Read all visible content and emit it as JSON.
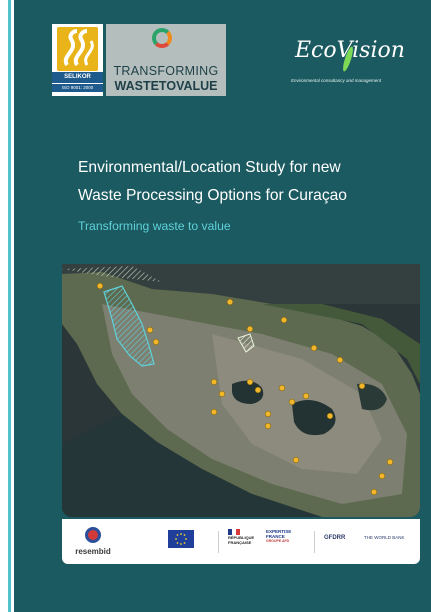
{
  "header": {
    "selikor": {
      "name": "SELIKOR",
      "iso": "ISO 9001: 2000"
    },
    "ttv": {
      "line1": "TRANSFORMING",
      "line2": "WASTETOVALUE"
    },
    "ecovision": {
      "brand": "EcoVision",
      "tagline": "Environmental consultancy and management"
    }
  },
  "cover": {
    "title_line1": "Environmental/Location Study for new",
    "title_line2": "Waste Processing Options for Curaçao",
    "subtitle": "Transforming waste to value"
  },
  "map": {
    "marker_count": 24,
    "marker_color": "#f2b62a",
    "highlight_color": "#5fd1da"
  },
  "footer": {
    "resembid": "resembid",
    "rf_line1": "RÉPUBLIQUE",
    "rf_line2": "FRANÇAISE",
    "expertise_line1": "EXPERTISE",
    "expertise_line2": "FRANCE",
    "expertise_line3": "GROUPE AFD",
    "gfdrr": "GFDRR",
    "worldbank": "THE WORLD BANK"
  },
  "colors": {
    "cover": "#1b5a60",
    "accent": "#5fd1da",
    "stripe": "#4fc3c9"
  }
}
